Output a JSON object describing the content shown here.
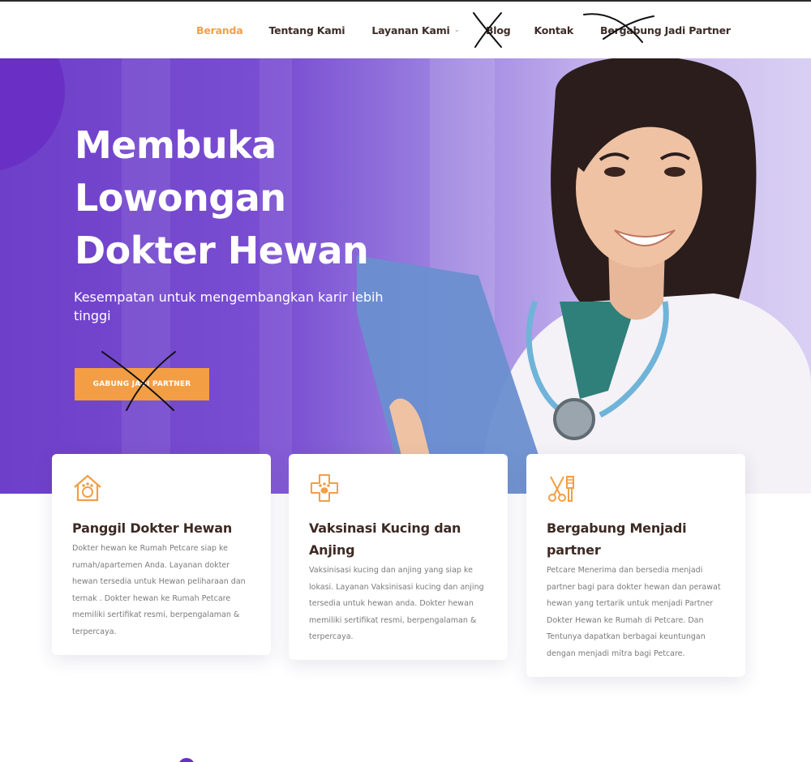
{
  "nav": {
    "items": [
      {
        "label": "Beranda",
        "active": true
      },
      {
        "label": "Tentang Kami",
        "active": false
      },
      {
        "label": "Layanan Kami",
        "active": false,
        "dropdown": true
      },
      {
        "label": "Blog",
        "active": false
      },
      {
        "label": "Kontak",
        "active": false
      },
      {
        "label": "Bergabung Jadi Partner",
        "active": false
      }
    ],
    "chevron_icon": "chevron-down-icon"
  },
  "hero": {
    "title": "Membuka Lowongan Dokter Hewan",
    "subtitle": "Kesempatan untuk mengembangkan karir lebih tinggi",
    "button_label": "GABUNG JADI PARTNER"
  },
  "cards": [
    {
      "icon": "house-paw-icon",
      "title": "Panggil Dokter Hewan",
      "text": "Dokter hewan ke Rumah Petcare  siap ke rumah/apartemen Anda. Layanan dokter hewan tersedia untuk Hewan peliharaan dan ternak . Dokter hewan ke Rumah Petcare memiliki sertifikat resmi, berpengalaman & terpercaya."
    },
    {
      "icon": "medical-cross-paw-icon",
      "title": "Vaksinasi Kucing dan Anjing",
      "text": "Vaksinisasi kucing dan anjing yang siap ke lokasi. Layanan Vaksinisasi kucing dan anjing tersedia untuk hewan anda. Dokter hewan memiliki sertifikat resmi, berpengalaman & terpercaya."
    },
    {
      "icon": "grooming-tools-icon",
      "title": "Bergabung Menjadi partner",
      "text": "Petcare Menerima dan bersedia menjadi partner bagi para dokter hewan dan perawat hewan yang tertarik untuk menjadi Partner Dokter Hewan ke Rumah di Petcare. Dan Tentunya dapatkan berbagai keuntungan dengan menjadi mitra bagi Petcare."
    }
  ],
  "colors": {
    "accent_orange": "#f39e45",
    "nav_active": "#f0a04b",
    "hero_purple": "#6e3fc9",
    "heading_dark": "#3d2a23"
  }
}
